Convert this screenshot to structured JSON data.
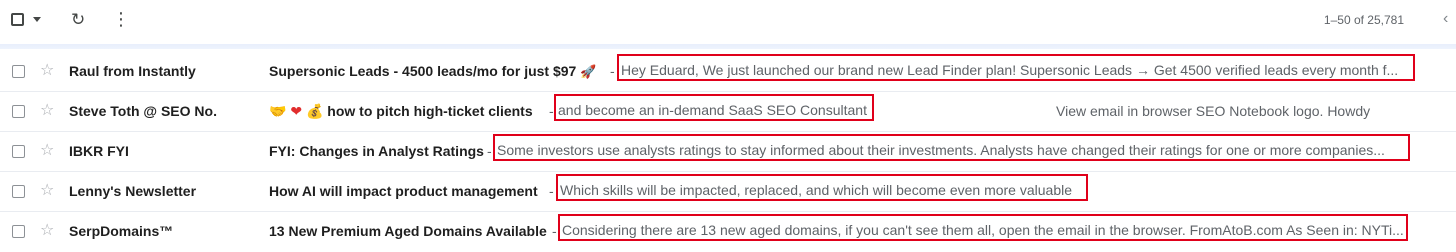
{
  "toolbar": {
    "refresh_icon": "refresh-icon",
    "more_icon": "more-vert-icon",
    "pagination": "1–50 of 25,781",
    "prev_icon": "chevron-left-icon"
  },
  "colors": {
    "highlight_box": "#e0001a",
    "text_primary": "#1f1f1f",
    "text_secondary": "#5f6368"
  },
  "emails": [
    {
      "sender": "Raul from Instantly",
      "subject": "Supersonic Leads - 4500 leads/mo for just $97",
      "subject_emoji": "🚀",
      "snippet": "Hey Eduard, We just launched our brand new Lead Finder plan! Supersonic Leads → Get 4500 verified leads every month f..."
    },
    {
      "sender": "Steve Toth @ SEO No.",
      "subject_emojis": [
        "🤝",
        "❤",
        "💰"
      ],
      "subject": "how to pitch high-ticket clients",
      "snippet": "and become an in-demand SaaS SEO Consultant",
      "extra": "View email in browser SEO Notebook logo. Howdy"
    },
    {
      "sender": "IBKR FYI",
      "subject": "FYI: Changes in Analyst Ratings",
      "snippet": "Some investors use analysts ratings to stay informed about their investments. Analysts have changed their ratings for one or more companies..."
    },
    {
      "sender": "Lenny's Newsletter",
      "subject": "How AI will impact product management",
      "snippet": "Which skills will be impacted, replaced, and which will become even more valuable"
    },
    {
      "sender": "SerpDomains™",
      "subject": "13 New Premium Aged Domains Available",
      "snippet": "Considering there are 13 new aged domains, if you can't see them all, open the email in the browser. FromAtoB.com As Seen in: NYTi..."
    }
  ]
}
